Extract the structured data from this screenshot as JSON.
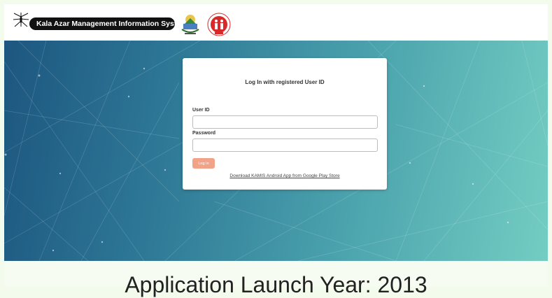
{
  "header": {
    "app_title": "Kala Azar Management Information System",
    "logos": [
      "state-emblem-logo",
      "health-department-logo"
    ]
  },
  "login": {
    "title": "Log In with registered User ID",
    "user_id_label": "User ID",
    "user_id_value": "",
    "password_label": "Password",
    "password_value": "",
    "login_button": "Log In",
    "download_link": "Download KAMIS Android App from Google Play Store"
  },
  "footer": {
    "launch_text": "Application Launch Year: 2013"
  },
  "colors": {
    "brand_pill": "#111111",
    "login_button": "#f2a287",
    "hero_start": "#1d5680",
    "hero_end": "#74cdc2"
  }
}
